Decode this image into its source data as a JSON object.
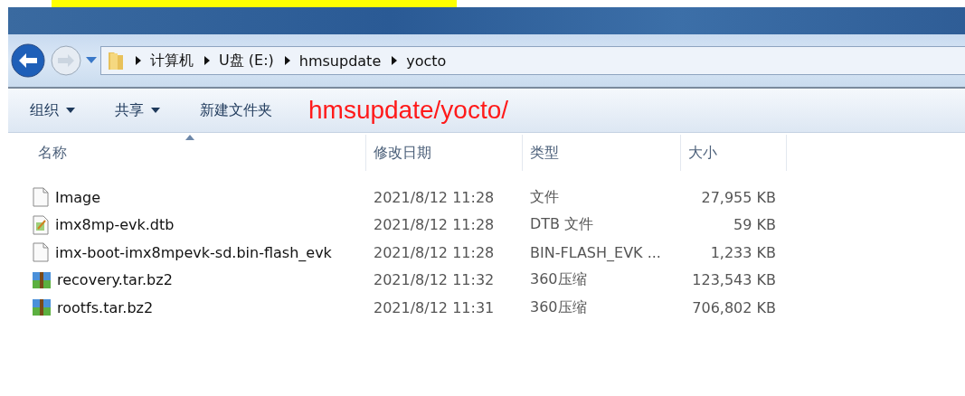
{
  "breadcrumb": [
    "计算机",
    "U盘 (E:)",
    "hmsupdate",
    "yocto"
  ],
  "toolbar": {
    "buttons": [
      {
        "label": "组织",
        "dropdown": true
      },
      {
        "label": "共享",
        "dropdown": true
      },
      {
        "label": "新建文件夹",
        "dropdown": false
      }
    ],
    "annotation": "hmsupdate/yocto/"
  },
  "table": {
    "columns": [
      {
        "label": "名称",
        "sorted": true
      },
      {
        "label": "修改日期",
        "sorted": false
      },
      {
        "label": "类型",
        "sorted": false
      },
      {
        "label": "大小",
        "sorted": false
      }
    ],
    "rows": [
      {
        "kind": "blank",
        "name": "Image",
        "date": "2021/8/12 11:28",
        "type": "文件",
        "size": "27,955 KB"
      },
      {
        "kind": "dtb",
        "name": "imx8mp-evk.dtb",
        "date": "2021/8/12 11:28",
        "type": "DTB 文件",
        "size": "59 KB"
      },
      {
        "kind": "blank",
        "name": "imx-boot-imx8mpevk-sd.bin-flash_evk",
        "date": "2021/8/12 11:28",
        "type": "BIN-FLASH_EVK ...",
        "size": "1,233 KB"
      },
      {
        "kind": "archive",
        "name": "recovery.tar.bz2",
        "date": "2021/8/12 11:32",
        "type": "360压缩",
        "size": "123,543 KB"
      },
      {
        "kind": "archive",
        "name": "rootfs.tar.bz2",
        "date": "2021/8/12 11:31",
        "type": "360压缩",
        "size": "706,802 KB"
      }
    ]
  }
}
